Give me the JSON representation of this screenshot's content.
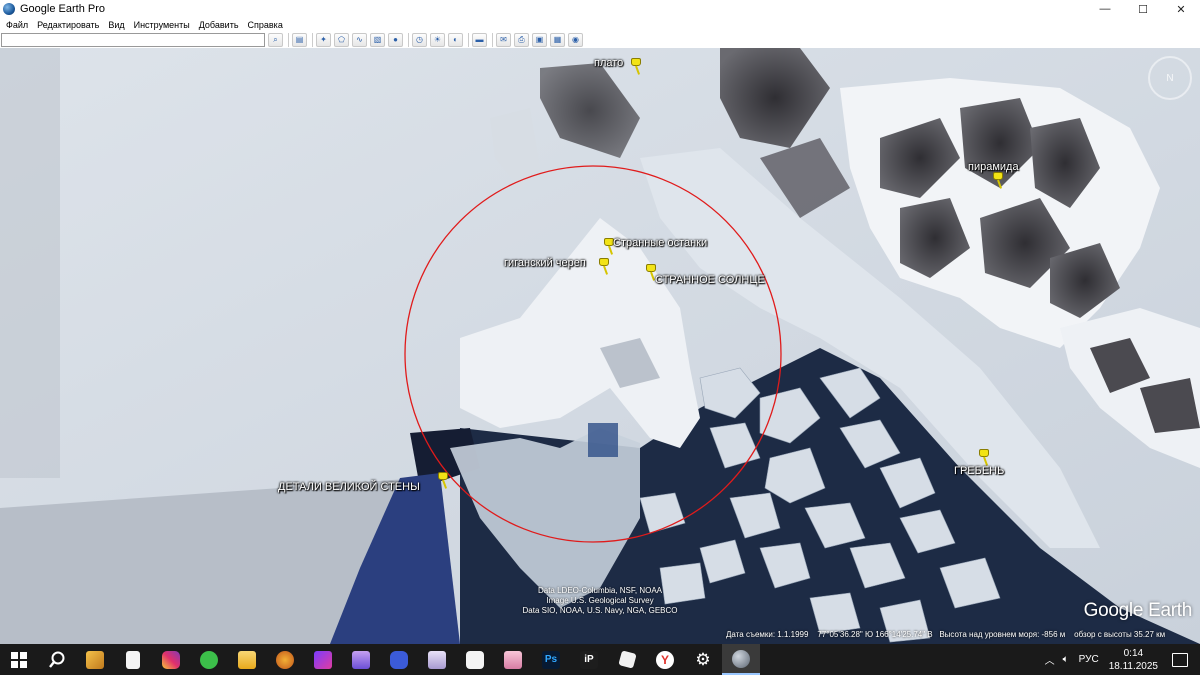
{
  "window": {
    "title": "Google Earth Pro",
    "minimize_glyph": "—",
    "maximize_glyph": "☐",
    "close_glyph": "✕"
  },
  "menu": [
    {
      "label": "Файл",
      "id": "file"
    },
    {
      "label": "Редактировать",
      "id": "edit"
    },
    {
      "label": "Вид",
      "id": "view"
    },
    {
      "label": "Инструменты",
      "id": "tools"
    },
    {
      "label": "Добавить",
      "id": "add"
    },
    {
      "label": "Справка",
      "id": "help"
    }
  ],
  "search": {
    "value": "",
    "placeholder": ""
  },
  "toolbar_icons": [
    "search-icon",
    "sidebar-icon",
    "placemark-icon",
    "polygon-icon",
    "path-icon",
    "image-overlay-icon",
    "tour-icon",
    "historical-imagery-icon",
    "sunlight-icon",
    "planets-icon",
    "ruler-icon",
    "email-icon",
    "print-icon",
    "save-image-icon",
    "view-in-maps-icon",
    "earth-gallery-icon"
  ],
  "placemarks": [
    {
      "id": "plato",
      "label": "плато"
    },
    {
      "id": "piramida",
      "label": "пирамида"
    },
    {
      "id": "strannye-ostanki",
      "label": "Странные останки"
    },
    {
      "id": "gigantskiy-cherep",
      "label": "гиганский череп"
    },
    {
      "id": "strannoe-solntse",
      "label": "СТРАННОЕ СОЛНЦЕ"
    },
    {
      "id": "greben",
      "label": "ГРЕБЕНЬ"
    },
    {
      "id": "detali-velikoy-steny",
      "label": "ДЕТАЛИ ВЕЛИКОЙ СТЕНЫ"
    }
  ],
  "attribution": {
    "line1": "Data LDEO-Columbia, NSF, NOAA",
    "line2": "Image U.S. Geological Survey",
    "line3": "Data SIO, NOAA, U.S. Navy, NGA, GEBCO"
  },
  "logo": "Google Earth",
  "status": {
    "imagery_date": "Дата съемки: 1.1.1999",
    "coords": "77°05'36.28\" Ю  166°14'25.74\" В",
    "elevation": "Высота над уровнем моря: -856 м",
    "eye_alt": "обзор с высоты 35.27 км"
  },
  "taskbar": {
    "apps": [
      "start-icon",
      "search-icon",
      "cleaner-icon",
      "file-icon",
      "instagram-icon",
      "chat-icon",
      "folder-icon",
      "browser-icon",
      "app-icon",
      "anime-icon",
      "shield-icon",
      "cat-icon",
      "capcut-icon",
      "avatar-icon",
      "photoshop-icon",
      "ip-icon",
      "roblox-icon",
      "yandex-icon",
      "settings-icon",
      "google-earth-icon"
    ],
    "lang": "РУС",
    "time": "0:14",
    "date": "18.11.2025"
  },
  "colors": {
    "circle": "#e01b1b",
    "pin": "#f2e316",
    "ocean_dark": "#1c2a44",
    "ocean_blue": "#2a3f7a",
    "ice": "#e3e8ee",
    "rock": "#3c3b3f"
  }
}
